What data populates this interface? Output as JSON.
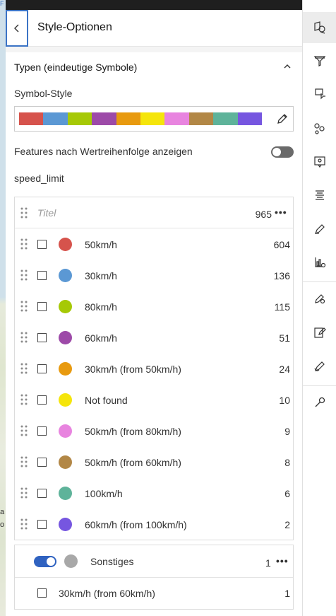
{
  "map_edge": {
    "chars": [
      "F",
      "a",
      "o"
    ]
  },
  "header": {
    "title": "Style-Optionen",
    "back_icon": "chevron-left-icon"
  },
  "section": {
    "title": "Typen (eindeutige Symbole)",
    "symbol_style_label": "Symbol-Style",
    "ramp_colors": [
      "#d6534c",
      "#5b98d4",
      "#a6c906",
      "#9d4aa8",
      "#e89a0f",
      "#f5e50b",
      "#e884df",
      "#b28746",
      "#5eb39a",
      "#7656e0"
    ],
    "order_toggle_label": "Features nach Wertreihenfolge anzeigen",
    "order_toggle_on": false,
    "field_name": "speed_limit"
  },
  "list": {
    "title_placeholder": "Titel",
    "total_count": "965",
    "more_label": "•••",
    "rows": [
      {
        "label": "50km/h",
        "count": "604",
        "color": "#d6534c"
      },
      {
        "label": "30km/h",
        "count": "136",
        "color": "#5b98d4"
      },
      {
        "label": "80km/h",
        "count": "115",
        "color": "#a6c906"
      },
      {
        "label": "60km/h",
        "count": "51",
        "color": "#9d4aa8"
      },
      {
        "label": "30km/h (from 50km/h)",
        "count": "24",
        "color": "#e89a0f"
      },
      {
        "label": "Not found",
        "count": "10",
        "color": "#f5e50b"
      },
      {
        "label": "50km/h (from 80km/h)",
        "count": "9",
        "color": "#e884df"
      },
      {
        "label": "50km/h (from 60km/h)",
        "count": "8",
        "color": "#b28746"
      },
      {
        "label": "100km/h",
        "count": "6",
        "color": "#5eb39a"
      },
      {
        "label": "60km/h (from 100km/h)",
        "count": "2",
        "color": "#7656e0"
      }
    ]
  },
  "other": {
    "label": "Sonstiges",
    "count": "1",
    "toggle_on": true,
    "color": "#a8a8a8",
    "rows": [
      {
        "label": "30km/h (from 60km/h)",
        "count": "1"
      }
    ]
  },
  "rightbar": {
    "items": [
      "styles-icon",
      "filter-icon",
      "effects-icon",
      "clustering-icon",
      "popups-icon",
      "labels-icon",
      "sketch-icon",
      "charts-icon",
      "field-edit-icon",
      "edit-form-icon",
      "edit-tool-icon",
      "configure-icon"
    ]
  }
}
